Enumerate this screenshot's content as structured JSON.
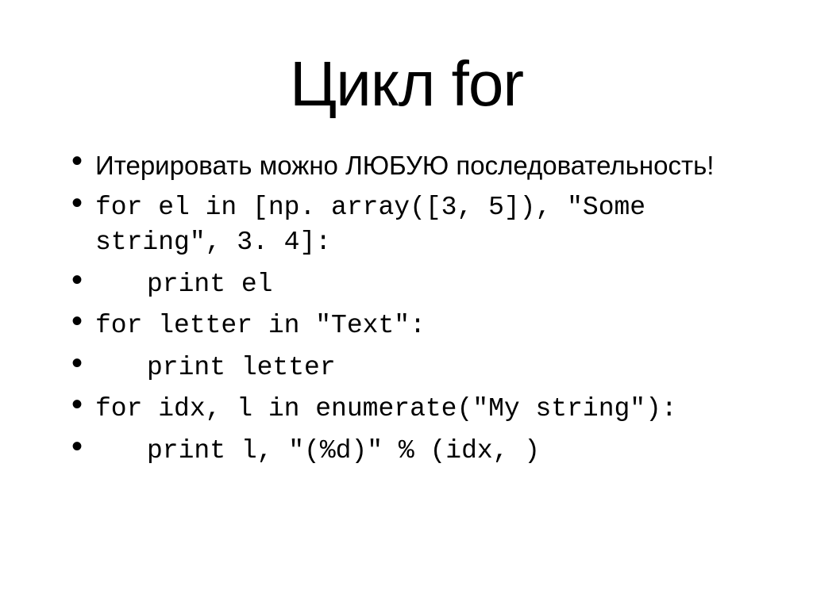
{
  "slide": {
    "title": "Цикл for",
    "bullets": [
      {
        "type": "regular",
        "text": "Итерировать можно ЛЮБУЮ последовательность!",
        "indented": false
      },
      {
        "type": "code",
        "text": "for el in [np. array([3, 5]), \"Some string\", 3. 4]:",
        "indented": false
      },
      {
        "type": "code",
        "text": "print el",
        "indented": true
      },
      {
        "type": "code",
        "text": "for letter in \"Text\":",
        "indented": false
      },
      {
        "type": "code",
        "text": "print letter",
        "indented": true
      },
      {
        "type": "code",
        "text": "for idx, l in enumerate(\"My string\"):",
        "indented": false
      },
      {
        "type": "code",
        "text": "print l, \"(%d)\" % (idx, )",
        "indented": true
      }
    ]
  }
}
